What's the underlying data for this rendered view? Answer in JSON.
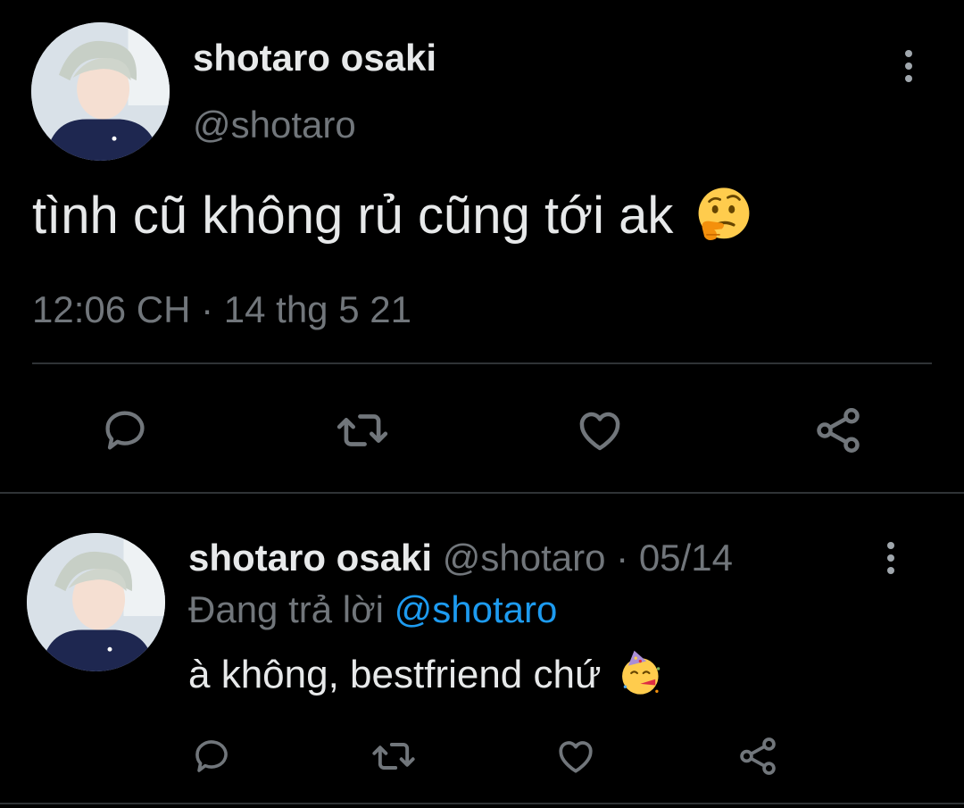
{
  "main_tweet": {
    "display_name": "shotaro osaki",
    "handle": "@shotaro",
    "text": "tình cũ không rủ cũng tới ak",
    "emoji": "thinking-face",
    "timestamp": "12:06 CH · 14 thg 5 21"
  },
  "reply_tweet": {
    "display_name": "shotaro osaki",
    "handle": "@shotaro",
    "date": "· 05/14",
    "replying_prefix": "Đang trả lời",
    "replying_to": "@shotaro",
    "text": "à không, bestfriend chứ",
    "emoji": "partying-face"
  },
  "actions": [
    "reply-icon",
    "retweet-icon",
    "like-icon",
    "share-icon"
  ],
  "colors": {
    "background": "#000000",
    "text": "#e7e9ea",
    "muted": "#71767b",
    "link": "#1d9bf0",
    "divider": "#2f3336"
  }
}
